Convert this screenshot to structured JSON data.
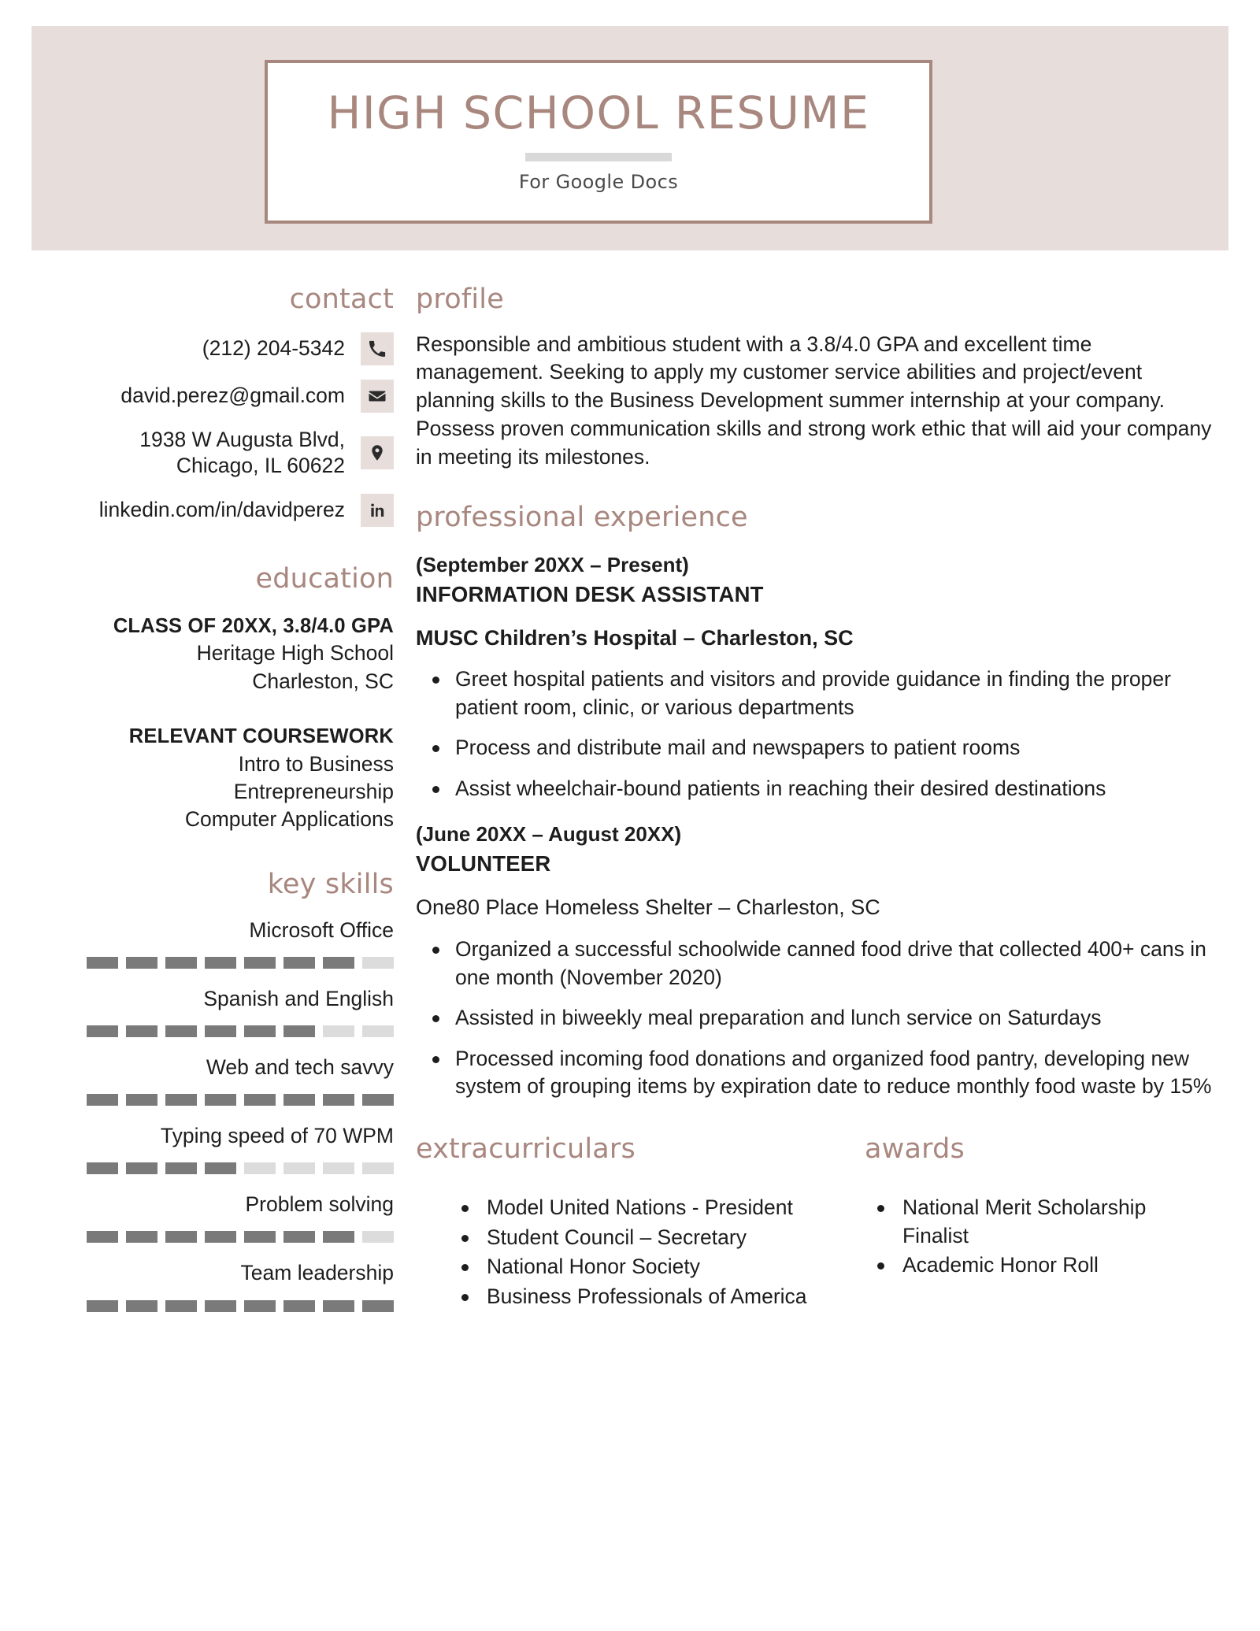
{
  "header": {
    "title": "HIGH SCHOOL RESUME",
    "subtitle": "For Google Docs",
    "band_color": "#e7dedc",
    "border_color": "#a8877f"
  },
  "theme": {
    "accent": "#a8877f",
    "band": "#e7dedc",
    "text": "#1d1d1d",
    "skill_filled": "#7a7a7a",
    "skill_empty": "#dcdcdc"
  },
  "contact": {
    "heading": "contact",
    "items": [
      {
        "icon": "phone-icon",
        "text": "(212) 204-5342"
      },
      {
        "icon": "envelope-icon",
        "text": "david.perez@gmail.com"
      },
      {
        "icon": "location-pin-icon",
        "text": "1938 W Augusta Blvd,\nChicago, IL 60622"
      },
      {
        "icon": "linkedin-icon",
        "text": "linkedin.com/in/davidperez"
      }
    ]
  },
  "education": {
    "heading": "education",
    "degree_line": "CLASS OF 20XX, 3.8/4.0 GPA",
    "school": "Heritage High School",
    "location": "Charleston, SC",
    "coursework_heading": "RELEVANT COURSEWORK",
    "courses": [
      "Intro to Business",
      "Entrepreneurship",
      "Computer Applications"
    ]
  },
  "key_skills": {
    "heading": "key skills",
    "segments_total": 8,
    "items": [
      {
        "label": "Microsoft Office",
        "filled": 7
      },
      {
        "label": "Spanish and English",
        "filled": 6
      },
      {
        "label": "Web and tech savvy",
        "filled": 8
      },
      {
        "label": "Typing speed of 70 WPM",
        "filled": 4
      },
      {
        "label": "Problem solving",
        "filled": 7
      },
      {
        "label": "Team leadership",
        "filled": 8
      }
    ]
  },
  "profile": {
    "heading": "profile",
    "text": "Responsible and ambitious student with a 3.8/4.0 GPA and excellent time management. Seeking to apply my customer service abilities and project/event planning skills to the Business Development summer internship at your company. Possess proven communication skills and strong work ethic that will aid your company in meeting its milestones."
  },
  "experience": {
    "heading": "professional experience",
    "jobs": [
      {
        "dates": "(September 20XX – Present)",
        "title": "INFORMATION DESK ASSISTANT",
        "organization": "MUSC Children’s Hospital – Charleston, SC",
        "organization_bold": true,
        "bullets": [
          "Greet hospital patients and visitors and provide guidance in finding the proper patient room, clinic, or various departments",
          "Process and distribute mail and newspapers to patient rooms",
          "Assist wheelchair-bound patients in reaching their desired destinations"
        ]
      },
      {
        "dates": "(June 20XX – August 20XX)",
        "title": "VOLUNTEER",
        "organization": "One80 Place Homeless Shelter – Charleston, SC",
        "organization_bold": false,
        "bullets": [
          "Organized a successful schoolwide canned food drive that collected 400+ cans in one month (November 2020)",
          "Assisted in biweekly meal preparation and lunch service on Saturdays",
          "Processed incoming food donations and organized food pantry, developing new system of grouping items by expiration date to reduce monthly food waste by 15%"
        ]
      }
    ]
  },
  "extracurriculars": {
    "heading": "extracurriculars",
    "items": [
      "Model United Nations - President",
      "Student Council – Secretary",
      "National Honor Society",
      "Business Professionals of America"
    ]
  },
  "awards": {
    "heading": "awards",
    "items": [
      "National Merit Scholarship Finalist",
      "Academic Honor Roll"
    ]
  }
}
